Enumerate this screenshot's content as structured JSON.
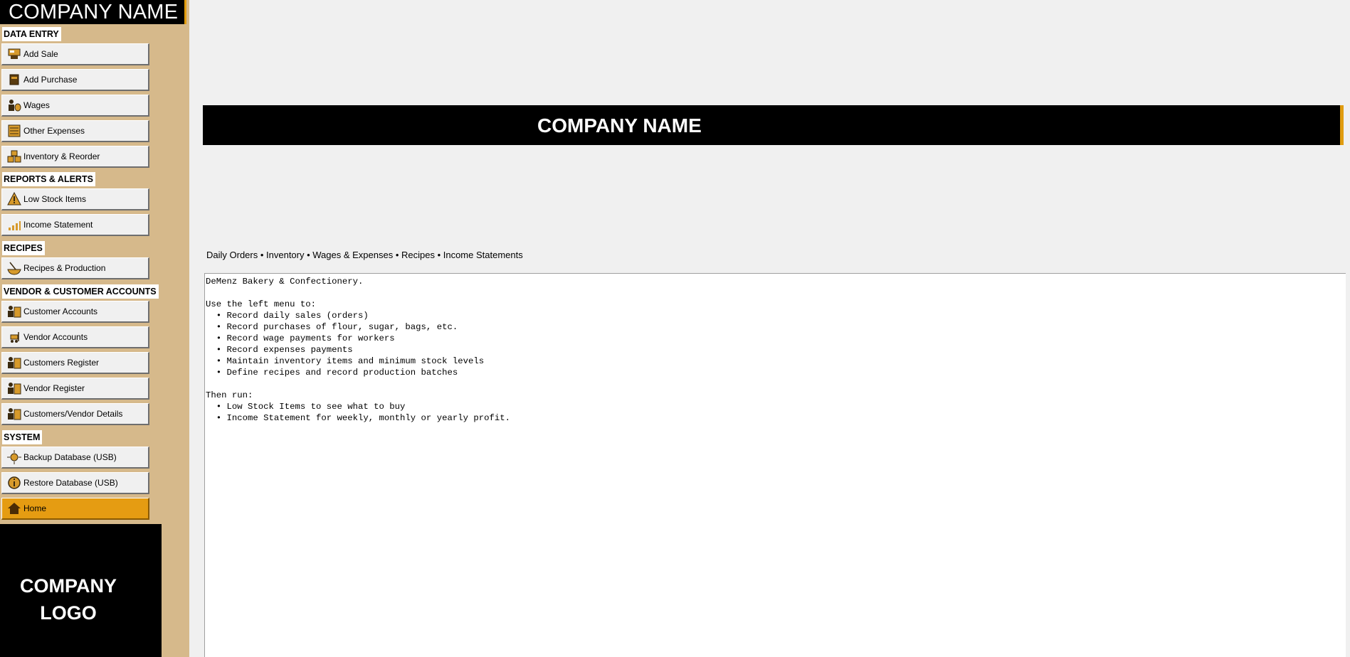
{
  "sidebar": {
    "company_name": "COMPANY NAME",
    "sections": {
      "data_entry": "DATA ENTRY",
      "reports": "REPORTS & ALERTS",
      "recipes": "RECIPES",
      "accounts": "VENDOR & CUSTOMER ACCOUNTS",
      "system": "SYSTEM"
    },
    "items": {
      "add_sale": "Add Sale",
      "add_purchase": "Add Purchase",
      "wages": "Wages",
      "other_expenses": "Other Expenses",
      "inventory": "Inventory & Reorder",
      "low_stock": "Low Stock Items",
      "income_statement": "Income Statement",
      "recipes": "Recipes & Production",
      "customer_accounts": "Customer Accounts",
      "vendor_accounts": "Vendor Accounts",
      "customers_register": "Customers Register",
      "vendor_register": "Vendor Register",
      "cv_details": "Customers/Vendor Details",
      "backup": "Backup Database (USB)",
      "restore": "Restore Database (USB)",
      "home": "Home"
    },
    "logo_line1": "COMPANY",
    "logo_line2": "LOGO"
  },
  "header": {
    "company_name": "COMPANY NAME"
  },
  "tagline": "Daily Orders • Inventory • Wages & Expenses • Recipes • Income Statements",
  "content_text": "DeMenz Bakery & Confectionery.\n\nUse the left menu to:\n  • Record daily sales (orders)\n  • Record purchases of flour, sugar, bags, etc.\n  • Record wage payments for workers\n  • Record expenses payments\n  • Maintain inventory items and minimum stock levels\n  • Define recipes and record production batches\n\nThen run:\n  • Low Stock Items to see what to buy\n  • Income Statement for weekly, monthly or yearly profit.",
  "colors": {
    "accent": "#e59c12",
    "sidebar_bg": "#d6b98b",
    "banner_bg": "#000000"
  },
  "icons": {
    "add_sale": "cash-register-icon",
    "add_purchase": "purchase-box-icon",
    "wages": "worker-money-icon",
    "other_expenses": "ledger-icon",
    "inventory": "boxes-icon",
    "low_stock": "warning-icon",
    "income_statement": "bar-chart-icon",
    "recipes": "mixing-bowl-icon",
    "accounts": "person-ledger-icon",
    "vendor_accounts": "forklift-icon",
    "backup": "sun-disk-icon",
    "restore": "info-circle-icon",
    "home": "home-icon"
  }
}
